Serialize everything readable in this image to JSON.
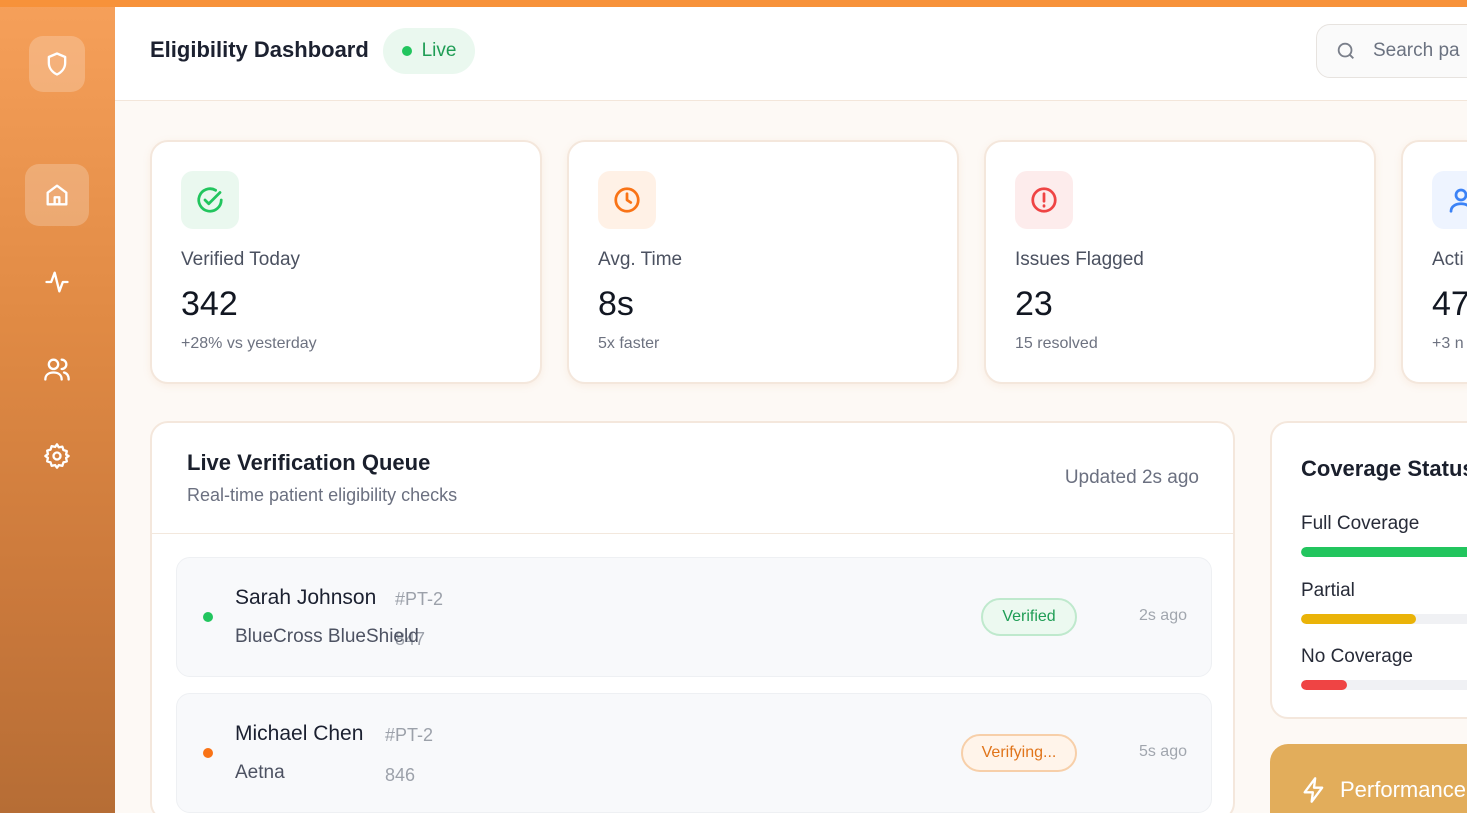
{
  "header": {
    "title": "Eligibility Dashboard",
    "live_label": "Live",
    "search_placeholder": "Search pa"
  },
  "sidebar": {
    "items": [
      {
        "name": "logo",
        "icon": "shield-icon"
      },
      {
        "name": "home",
        "icon": "home-icon",
        "active": true
      },
      {
        "name": "activity",
        "icon": "activity-icon"
      },
      {
        "name": "users",
        "icon": "users-icon"
      },
      {
        "name": "settings",
        "icon": "gear-icon"
      }
    ]
  },
  "stats": [
    {
      "label": "Verified Today",
      "value": "342",
      "sub": "+28% vs yesterday",
      "icon": "check-circle-icon",
      "color": "#22c55e"
    },
    {
      "label": "Avg. Time",
      "value": "8s",
      "sub": "5x faster",
      "icon": "clock-icon",
      "color": "#f97316"
    },
    {
      "label": "Issues Flagged",
      "value": "23",
      "sub": "15 resolved",
      "icon": "alert-circle-icon",
      "color": "#ef4444"
    },
    {
      "label": "Acti",
      "value": "47",
      "sub": "+3 n",
      "icon": "user-icon",
      "color": "#3b82f6"
    }
  ],
  "queue": {
    "title": "Live Verification Queue",
    "subtitle": "Real-time patient eligibility checks",
    "updated": "Updated 2s ago",
    "rows": [
      {
        "name": "Sarah Johnson",
        "id": "#PT-2 847",
        "insurer": "BlueCross BlueShield",
        "status": "Verified",
        "time": "2s ago",
        "dot_color": "#22c55e"
      },
      {
        "name": "Michael Chen",
        "id": "#PT-2 846",
        "insurer": "Aetna",
        "status": "Verifying...",
        "time": "5s ago",
        "dot_color": "#f97316"
      }
    ]
  },
  "coverage": {
    "title": "Coverage Status",
    "items": [
      {
        "label": "Full Coverage",
        "fraction": 0.78,
        "color": "#22c55e"
      },
      {
        "label": "Partial",
        "fraction": 0.5,
        "color": "#eab308"
      },
      {
        "label": "No Coverage",
        "fraction": 0.2,
        "color": "#ef4444"
      }
    ]
  },
  "performance": {
    "title": "Performance"
  }
}
